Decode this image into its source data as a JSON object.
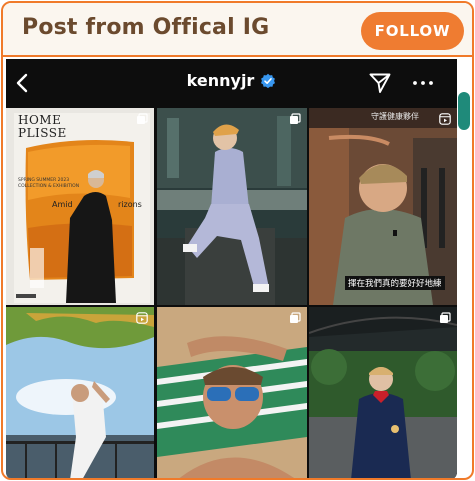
{
  "card": {
    "title": "Post from Offical IG",
    "follow_label": "FOLLOW"
  },
  "instagram": {
    "username": "kennyjr",
    "verified": true,
    "icons": [
      "back-arrow-icon",
      "verified-badge-icon",
      "send-icon",
      "more-icon"
    ]
  },
  "posts": [
    {
      "type": "photo",
      "poster_brand_line1": "HOME",
      "poster_brand_line2": "PLISSE",
      "poster_small_line1": "SPRING SUMMER 2023",
      "poster_small_line2": "COLLECTION & EXHIBITION",
      "poster_left_text": "Amid",
      "poster_right_text": "rizons",
      "badge_icon": "multiple-icon"
    },
    {
      "type": "photo",
      "badge_icon": "multiple-icon"
    },
    {
      "type": "reel",
      "sign_text": "守護健康夥伴",
      "subtitle": "揮在我們真的要好好地練",
      "badge_icon": "reel-icon"
    },
    {
      "type": "reel",
      "badge_icon": "reel-icon"
    },
    {
      "type": "photo",
      "badge_icon": "multiple-icon"
    },
    {
      "type": "photo",
      "badge_icon": "multiple-icon"
    }
  ],
  "colors": {
    "accent": "#ef7c31",
    "title": "#6b4a2e",
    "header_bg": "#fbf6ef",
    "ig_bg": "#0d0d0d",
    "verified": "#3897f0",
    "scroll_handle": "#1f8a7a"
  }
}
